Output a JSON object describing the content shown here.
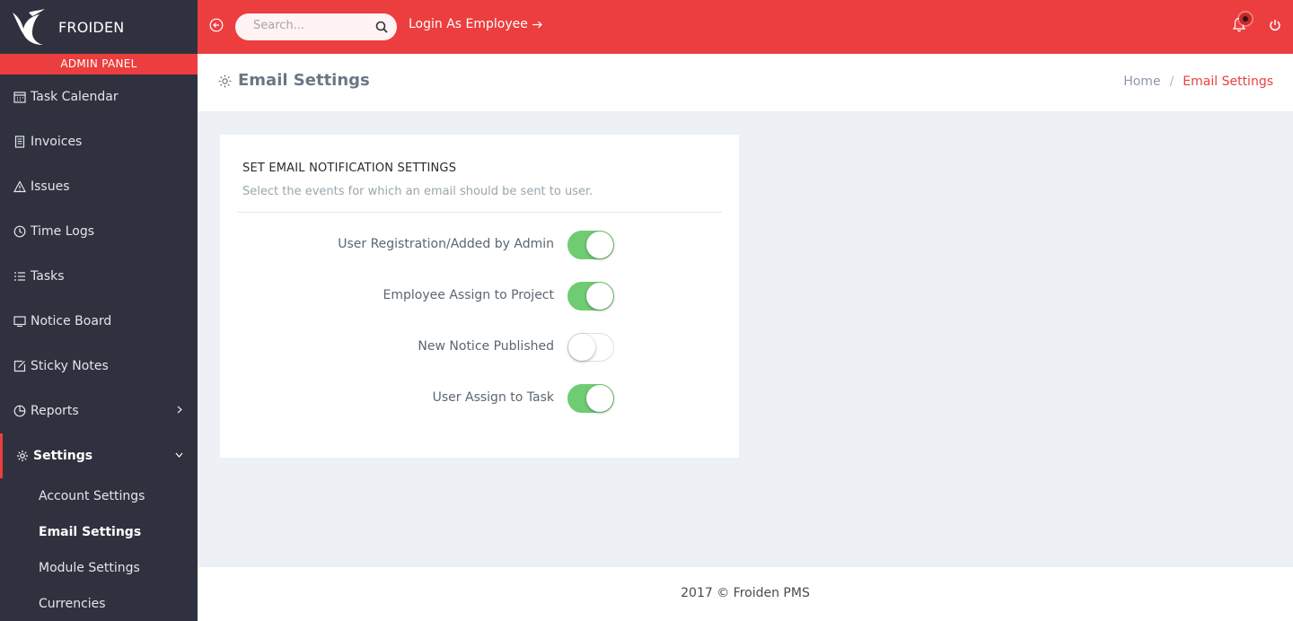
{
  "brand": {
    "name": "FROIDEN",
    "panel_label": "ADMIN PANEL"
  },
  "sidebar": {
    "items": [
      {
        "label": "Task Calendar",
        "icon": "calendar-icon"
      },
      {
        "label": "Invoices",
        "icon": "file-icon"
      },
      {
        "label": "Issues",
        "icon": "warning-icon"
      },
      {
        "label": "Time Logs",
        "icon": "clock-icon"
      },
      {
        "label": "Tasks",
        "icon": "list-icon"
      },
      {
        "label": "Notice Board",
        "icon": "monitor-icon"
      },
      {
        "label": "Sticky Notes",
        "icon": "note-icon"
      },
      {
        "label": "Reports",
        "icon": "pie-chart-icon"
      },
      {
        "label": "Settings",
        "icon": "gear-icon"
      }
    ],
    "settings_sub": [
      {
        "label": "Account Settings"
      },
      {
        "label": "Email Settings"
      },
      {
        "label": "Module Settings"
      },
      {
        "label": "Currencies"
      }
    ]
  },
  "topbar": {
    "search_placeholder": "Search...",
    "login_as_employee": "Login As Employee"
  },
  "page": {
    "title": "Email Settings",
    "breadcrumb": {
      "home": "Home",
      "current": "Email Settings"
    }
  },
  "card": {
    "heading": "SET EMAIL NOTIFICATION SETTINGS",
    "description": "Select the events for which an email should be sent to user.",
    "settings": [
      {
        "label": "User Registration/Added by Admin",
        "enabled": true
      },
      {
        "label": "Employee Assign to Project",
        "enabled": true
      },
      {
        "label": "New Notice Published",
        "enabled": false
      },
      {
        "label": "User Assign to Task",
        "enabled": true
      }
    ]
  },
  "footer": {
    "text": "2017 © Froiden PMS"
  },
  "colors": {
    "accent": "#ec3e3e",
    "sidebar": "#2f323e",
    "switch_on": "#6fcc73"
  }
}
